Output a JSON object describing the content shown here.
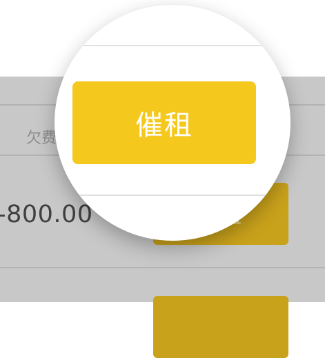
{
  "background": {
    "owed_label": "欠费",
    "amount": "-800.00",
    "remind_button_label": "催租"
  },
  "magnifier": {
    "remind_button_label": "催租"
  },
  "colors": {
    "accent": "#f5c81d",
    "accent_dimmed": "#c9a21b",
    "overlay": "#c8c8c8"
  }
}
